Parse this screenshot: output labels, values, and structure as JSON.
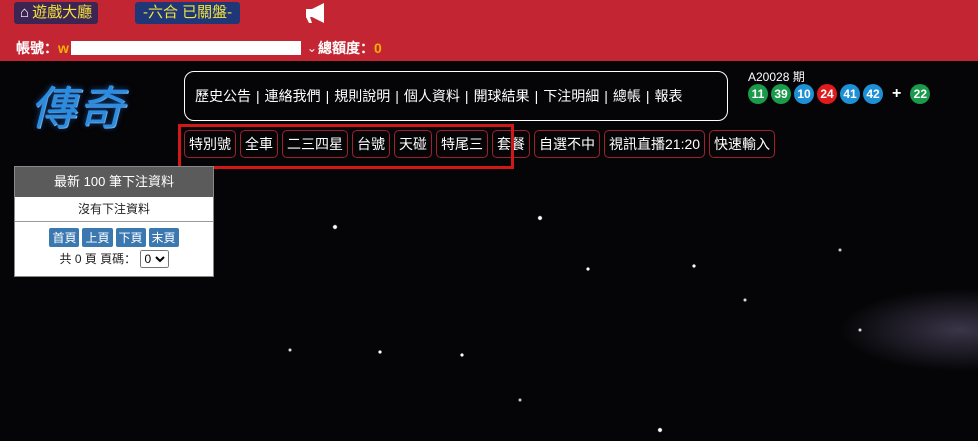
{
  "header": {
    "lobby_label": "遊戲大廳",
    "lottery_label": "-六合 已關盤-",
    "account_label": "帳號：",
    "account_prefix": "w",
    "credit_label": "總額度：",
    "credit_value": "0"
  },
  "logo": {
    "text": "傳奇"
  },
  "nav": {
    "items": [
      "歷史公告",
      "連絡我們",
      "規則說明",
      "個人資料",
      "開球結果",
      "下注明細",
      "總帳",
      "報表"
    ]
  },
  "draw": {
    "period": "A20028 期",
    "numbers": [
      {
        "n": "11",
        "color": "#1a9a4a"
      },
      {
        "n": "39",
        "color": "#1a9a4a"
      },
      {
        "n": "10",
        "color": "#1e90d6"
      },
      {
        "n": "24",
        "color": "#e01b1b"
      },
      {
        "n": "41",
        "color": "#1e90d6"
      },
      {
        "n": "42",
        "color": "#1e90d6"
      }
    ],
    "plus": "+",
    "special": {
      "n": "22",
      "color": "#1a9a4a"
    }
  },
  "tabs": [
    "特別號",
    "全車",
    "二三四星",
    "台號",
    "天碰",
    "特尾三",
    "套餐",
    "自選不中",
    "視訊直播21:20",
    "快速輸入"
  ],
  "panel": {
    "title": "最新 100 筆下注資料",
    "empty": "沒有下注資料",
    "buttons": [
      "首頁",
      "上頁",
      "下頁",
      "末頁"
    ],
    "total_prefix": "共",
    "total_pages": "0",
    "total_suffix": "頁 頁碼：",
    "page_value": "0"
  }
}
